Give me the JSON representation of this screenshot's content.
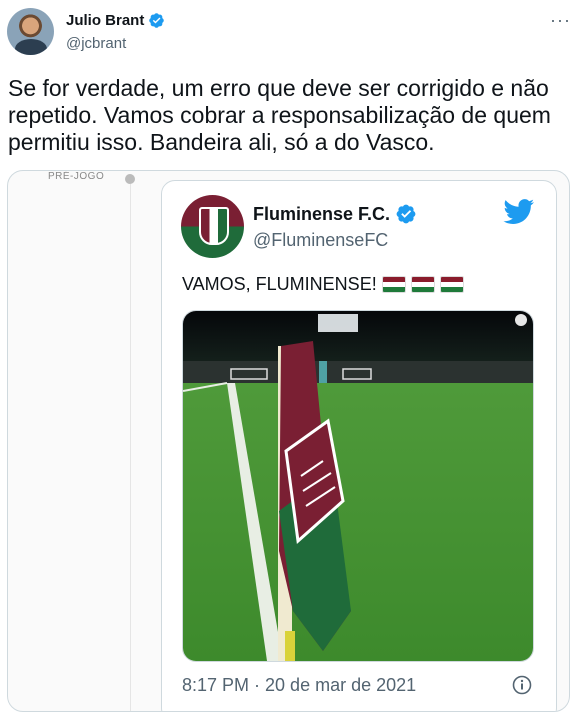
{
  "tweet": {
    "author_name": "Julio Brant",
    "author_handle": "@jcbrant",
    "text": "Se for verdade, um erro que deve ser corrigido e não repetido. Vamos cobrar a responsabilização de quem permitiu isso. Bandeira ali, só a do Vasco."
  },
  "media": {
    "timeline_label": "PRÉ-JOGO",
    "embedded_tweet": {
      "author_name": "Fluminense F.C.",
      "author_handle": "@FluminenseFC",
      "text": "VAMOS, FLUMINENSE!",
      "timestamp": "8:17 PM · 20 de mar de 2021"
    }
  },
  "colors": {
    "verified": "#1d9bf0",
    "twitter_brand": "#1d9bf0",
    "fluminense_grena": "#7a1f33",
    "fluminense_verde": "#1f6b3a"
  },
  "icons": [
    "verified-badge-icon",
    "more-options-icon",
    "twitter-bird-icon",
    "info-icon"
  ]
}
